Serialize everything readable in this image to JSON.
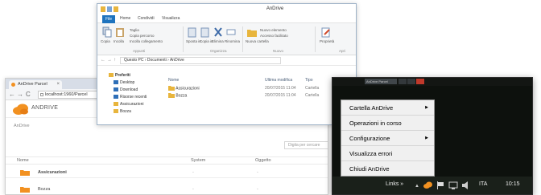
{
  "browser": {
    "tab_title": "AnDrive Parcel",
    "url": "localhost:1960/Parcel",
    "brand": "ANDRIVE",
    "breadcrumb": "AnDrive",
    "search_placeholder": "Digita per cercare",
    "columns": {
      "name": "Nome",
      "system": "System",
      "object": "Oggetto"
    },
    "rows": [
      {
        "name": "Assicurazioni",
        "col2": "-",
        "col3": "-"
      },
      {
        "name": "Bozza",
        "col2": "-",
        "col3": "-"
      }
    ]
  },
  "explorer": {
    "title": "AnDrive",
    "menus": {
      "file": "File",
      "home": "Home",
      "share": "Condividi",
      "view": "Visualizza"
    },
    "ribbon": {
      "copy": "Copia",
      "paste": "Incolla",
      "cut": "Taglia",
      "copy_path": "Copia percorso",
      "paste_shortcut": "Incolla collegamento",
      "move_to": "Sposta in",
      "copy_to": "Copia in",
      "delete": "Elimina",
      "rename": "Rinomina",
      "new_folder": "Nuova cartella",
      "new_item": "Nuovo elemento",
      "easy_access": "Accesso facilitato",
      "properties": "Proprietà",
      "group_clipboard": "Appunti",
      "group_organize": "Organizza",
      "group_new": "Nuovo",
      "group_open": "Apri"
    },
    "address": "Questo PC  ›  Documenti  ›  AnDrive",
    "nav": [
      "Preferiti",
      "Desktop",
      "Download",
      "Risorse recenti",
      "Assicurazioni",
      "Bozza"
    ],
    "columns": {
      "name": "Nome",
      "date": "Ultima modifica",
      "type": "Tipo"
    },
    "files": [
      {
        "name": "Assicurazioni",
        "date": "20/07/2015 11:04",
        "type": "Cartella"
      },
      {
        "name": "Bozza",
        "date": "20/07/2015 11:04",
        "type": "Cartella"
      }
    ]
  },
  "tray_window": {
    "title": "AnDrive Parcel"
  },
  "context_menu": {
    "items": [
      {
        "label": "Cartella AnDrive",
        "submenu": true
      },
      {
        "label": "Operazioni in corso",
        "submenu": false
      },
      {
        "label": "Configurazione",
        "submenu": true
      },
      {
        "label": "Visualizza errori",
        "submenu": false
      },
      {
        "label": "Chiudi AnDrive",
        "submenu": false
      }
    ]
  },
  "taskbar": {
    "links": "Links",
    "chevron": "»",
    "language": "ITA",
    "time": "10:15"
  },
  "colors": {
    "accent_orange": "#f29121",
    "folder_yellow": "#e8b53d",
    "ribbon_blue": "#1e73be",
    "taskbar": "#1a201a"
  },
  "icons": [
    "folder-icon",
    "back-icon",
    "forward-icon",
    "refresh-icon",
    "andrive-tray-icon",
    "flag-icon",
    "network-icon",
    "volume-icon",
    "submenu-arrow-icon"
  ]
}
